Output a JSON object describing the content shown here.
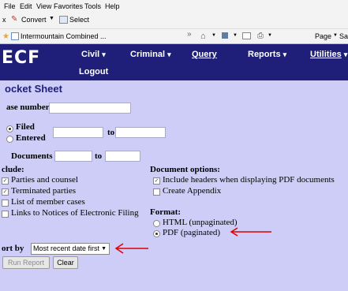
{
  "browser": {
    "menu": [
      "File",
      "Edit",
      "View",
      "Favorites",
      "Tools",
      "Help"
    ],
    "toolbar": {
      "close_glyph": "x",
      "convert_label": "Convert",
      "select_label": "Select",
      "overflow": "»",
      "page_label": "Page",
      "safety_label": "Sa"
    },
    "favorite_tab": "Intermountain Combined ..."
  },
  "ecf": {
    "logo": "ECF",
    "nav": {
      "civil": "Civil",
      "criminal": "Criminal",
      "query": "Query",
      "reports": "Reports",
      "utilities": "Utilities",
      "logout": "Logout"
    },
    "caret": "▾"
  },
  "form": {
    "heading": "ocket Sheet",
    "case_number_label": "ase number",
    "filed_label": "Filed",
    "entered_label": "Entered",
    "to_label": "to",
    "documents_label": "Documents",
    "include_label": "clude:",
    "include_options": [
      "Parties and counsel",
      "Terminated parties",
      "List of member cases",
      "Links to Notices of Electronic Filing"
    ],
    "doc_options_label": "Document options:",
    "doc_options": [
      "Include headers when displaying PDF documents",
      "Create Appendix"
    ],
    "format_label": "Format:",
    "format_options": [
      "HTML (unpaginated)",
      "PDF (paginated)"
    ],
    "sort_label": "ort by",
    "sort_value": "Most recent date first",
    "run_button": "Run Report",
    "clear_button": "Clear"
  },
  "colors": {
    "page_bg": "#cdcdf7",
    "nav_bg": "#1f1f7a",
    "arrow": "#e00000"
  }
}
